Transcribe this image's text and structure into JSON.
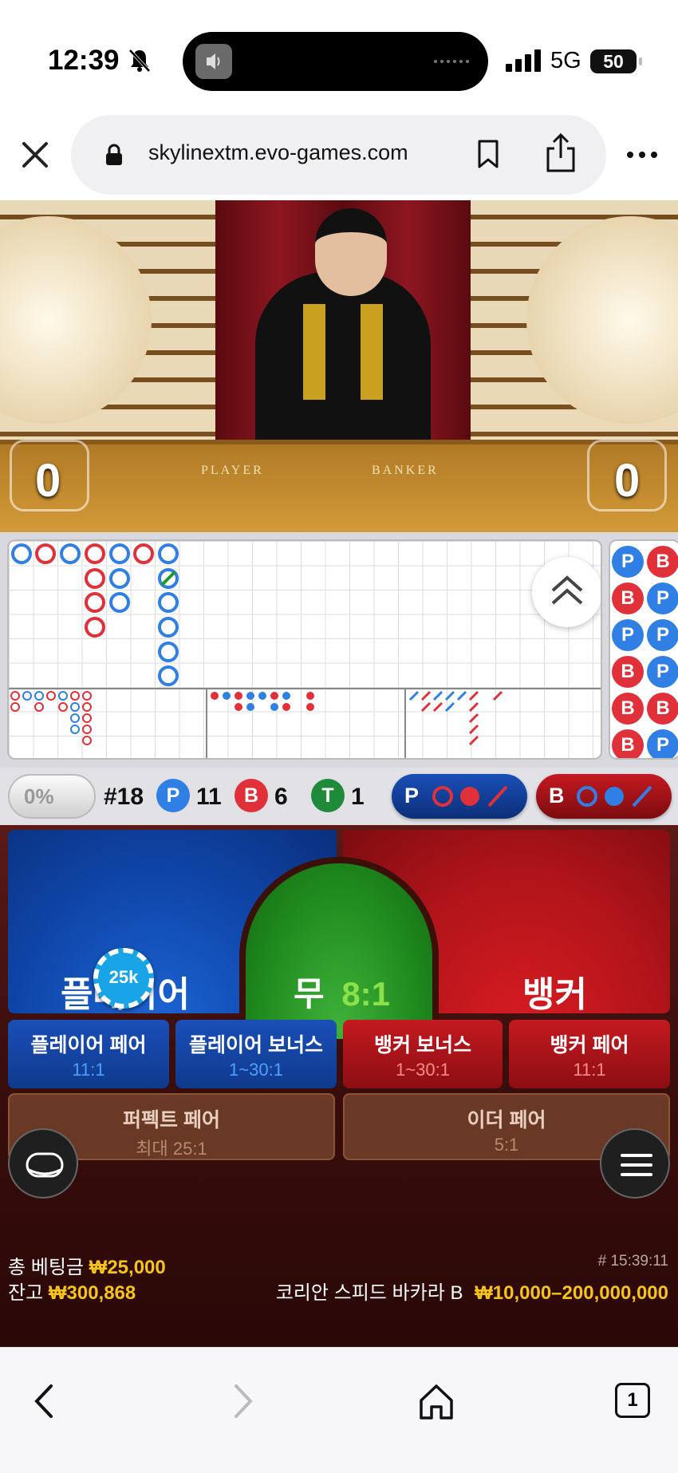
{
  "status_bar": {
    "time": "12:39",
    "network": "5G",
    "battery": "50"
  },
  "browser": {
    "url": "skylinextm.evo-games.com",
    "tab_count": "1"
  },
  "video": {
    "table_labels": [
      "PLAYER",
      "BANKER"
    ],
    "player_score": "0",
    "banker_score": "0"
  },
  "side_road": [
    "P",
    "B",
    "B",
    "P",
    "P",
    "P",
    "B",
    "P",
    "B",
    "B",
    "B",
    "P"
  ],
  "stats": {
    "percent": "0%",
    "round": "#18",
    "player_label": "P",
    "player_count": "11",
    "banker_label": "B",
    "banker_count": "6",
    "tie_label": "T",
    "tie_count": "1",
    "predict_player": "P",
    "predict_banker": "B"
  },
  "bet": {
    "player": "플레이어",
    "tie": "무",
    "tie_odds": "8:1",
    "banker": "뱅커",
    "chip": "25k",
    "side_bets": [
      {
        "title": "플레이어 페어",
        "odds": "11:1"
      },
      {
        "title": "플레이어 보너스",
        "odds": "1~30:1"
      },
      {
        "title": "뱅커 보너스",
        "odds": "1~30:1"
      },
      {
        "title": "뱅커 페어",
        "odds": "11:1"
      }
    ],
    "perfect_pair": {
      "title": "퍼펙트 페어",
      "odds": "최대 25:1"
    },
    "either_pair": {
      "title": "이더 페어",
      "odds": "5:1"
    }
  },
  "footer": {
    "total_bet_label": "총 베팅금",
    "total_bet": "₩25,000",
    "balance_label": "잔고",
    "balance": "₩300,868",
    "game_id": "# 15:39:11",
    "table_name": "코리안 스피드 바카라 B",
    "limits": "₩10,000–200,000,000"
  }
}
